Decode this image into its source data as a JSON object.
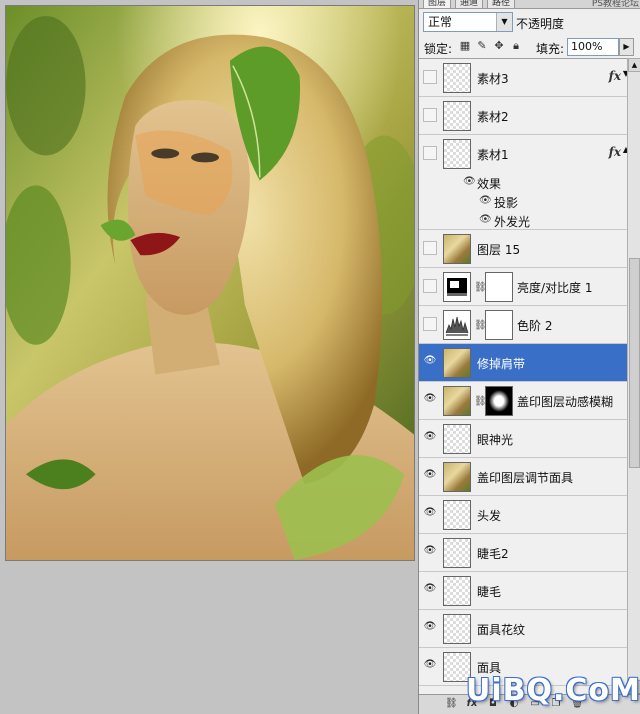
{
  "tabs": [
    {
      "label": "图层",
      "active": true
    },
    {
      "label": "通道",
      "active": false
    },
    {
      "label": "路径",
      "active": false
    }
  ],
  "watermark_top": "PS教程论坛",
  "blend_mode": "正常",
  "opacity_label": "不透明度",
  "lock_label": "锁定:",
  "lock_icons": [
    "checkerboard-lock-icon",
    "brush-lock-icon",
    "move-lock-icon",
    "padlock-icon"
  ],
  "fill_label": "填充:",
  "fill_value": "100%",
  "layers": [
    {
      "name": "素材3",
      "visible": false,
      "thumb": "transparent",
      "fx": "fx"
    },
    {
      "name": "素材2",
      "visible": false,
      "thumb": "transparent"
    },
    {
      "name": "素材1",
      "visible": false,
      "thumb": "transparent",
      "fx": "fx"
    },
    {
      "name": "效果",
      "sub": true,
      "level": 1
    },
    {
      "name": "投影",
      "sub": true,
      "level": 2
    },
    {
      "name": "外发光",
      "sub": true,
      "level": 2
    },
    {
      "name": "图层 15",
      "visible": false,
      "thumb": "photo"
    },
    {
      "name": "亮度/对比度 1",
      "visible": false,
      "thumb": "brightness-contrast",
      "mask": "white"
    },
    {
      "name": "色阶 2",
      "visible": false,
      "thumb": "levels",
      "mask": "white"
    },
    {
      "name": "修掉肩带",
      "visible": true,
      "thumb": "photo",
      "selected": true
    },
    {
      "name": "盖印图层动感模糊",
      "visible": true,
      "thumb": "photo",
      "mask": "dark"
    },
    {
      "name": "眼神光",
      "visible": true,
      "thumb": "transparent"
    },
    {
      "name": "盖印图层调节面具",
      "visible": true,
      "thumb": "photo"
    },
    {
      "name": "头发",
      "visible": true,
      "thumb": "transparent"
    },
    {
      "name": "睫毛2",
      "visible": true,
      "thumb": "transparent"
    },
    {
      "name": "睫毛",
      "visible": true,
      "thumb": "transparent"
    },
    {
      "name": "面具花纹",
      "visible": true,
      "thumb": "transparent"
    },
    {
      "name": "面具",
      "visible": true,
      "thumb": "transparent"
    }
  ],
  "footer_icons": [
    "link-icon",
    "fx-icon",
    "mask-icon",
    "adjustment-icon",
    "folder-icon",
    "new-layer-icon",
    "trash-icon"
  ],
  "watermark_bottom": "UiBQ.CoM"
}
